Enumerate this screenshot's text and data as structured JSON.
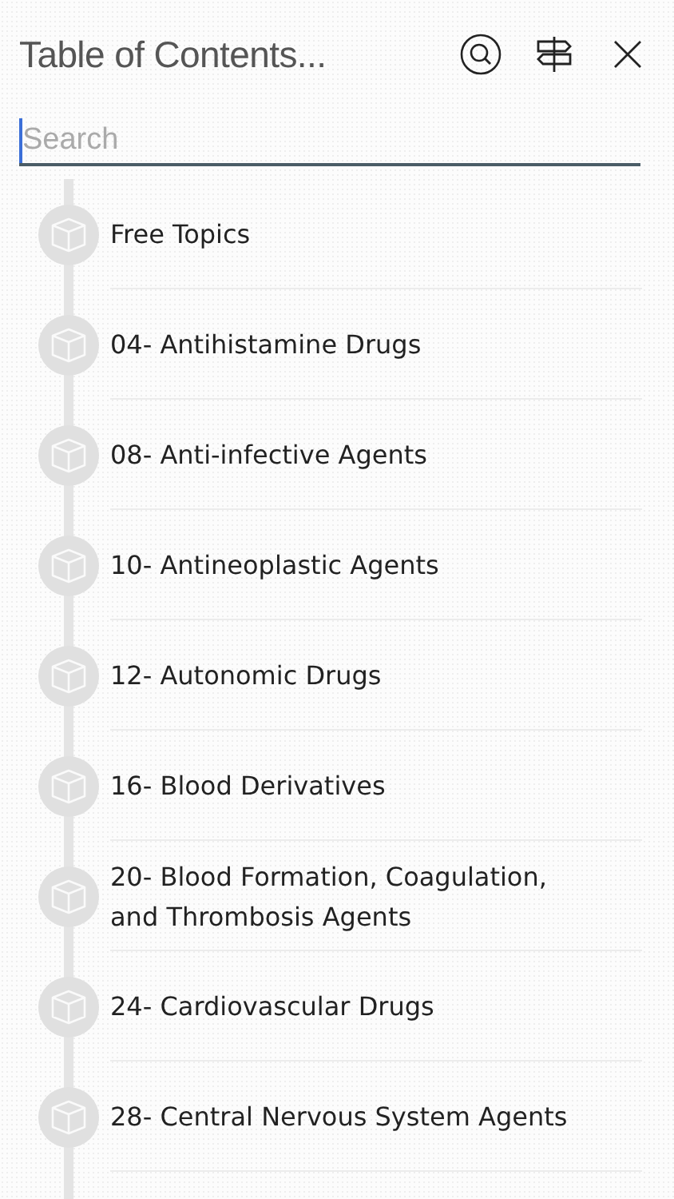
{
  "header": {
    "title": "Table of Contents..."
  },
  "search": {
    "placeholder": "Search"
  },
  "items": [
    {
      "label": "Free Topics"
    },
    {
      "label": "04- Antihistamine Drugs"
    },
    {
      "label": "08- Anti-infective Agents"
    },
    {
      "label": "10- Antineoplastic Agents"
    },
    {
      "label": "12- Autonomic Drugs"
    },
    {
      "label": "16- Blood Derivatives"
    },
    {
      "label": "20- Blood Formation, Coagulation, and Thrombosis Agents"
    },
    {
      "label": "24- Cardiovascular Drugs"
    },
    {
      "label": "28- Central Nervous System Agents"
    }
  ]
}
